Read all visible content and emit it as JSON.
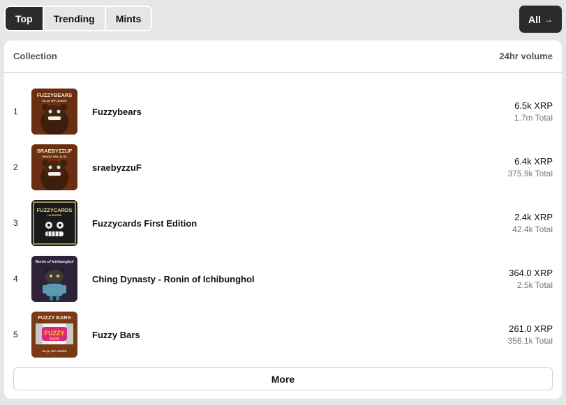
{
  "tabs": [
    {
      "label": "Top",
      "active": true
    },
    {
      "label": "Trending",
      "active": false
    },
    {
      "label": "Mints",
      "active": false
    }
  ],
  "all_button": {
    "label": "All",
    "icon": "arrow-right-icon"
  },
  "table": {
    "col_collection": "Collection",
    "col_volume": "24hr volume",
    "rows": [
      {
        "rank": "1",
        "name": "Fuzzybears",
        "volume": "6.5k XRP",
        "total": "1.7m Total",
        "thumb_text": "FUZZYBEARS",
        "thumb_sub": "ON {X} XRP LEDGER"
      },
      {
        "rank": "2",
        "name": "sraebyzzuF",
        "volume": "6.4k XRP",
        "total": "375.9k Total",
        "thumb_text": "SRAEBYZZUF",
        "thumb_sub": "REGDEL PRX {X} NO"
      },
      {
        "rank": "3",
        "name": "Fuzzycards First Edition",
        "volume": "2.4k XRP",
        "total": "42.4k Total",
        "thumb_text": "FUZZYCARDS",
        "thumb_sub": "1st EDITION"
      },
      {
        "rank": "4",
        "name": "Ching Dynasty - Ronin of Ichibunghol",
        "volume": "364.0 XRP",
        "total": "2.5k Total",
        "thumb_text": "Ronin of Ichibunghol",
        "thumb_sub": ""
      },
      {
        "rank": "5",
        "name": "Fuzzy Bars",
        "volume": "261.0 XRP",
        "total": "356.1k Total",
        "thumb_text": "FUZZY BARS",
        "thumb_sub": "ON {X} XRP LEDGER"
      }
    ]
  },
  "more_button": {
    "label": "More"
  },
  "colors": {
    "dark": "#2b2b2b",
    "page_bg": "#e6e6e6",
    "card_bg": "#ffffff"
  }
}
